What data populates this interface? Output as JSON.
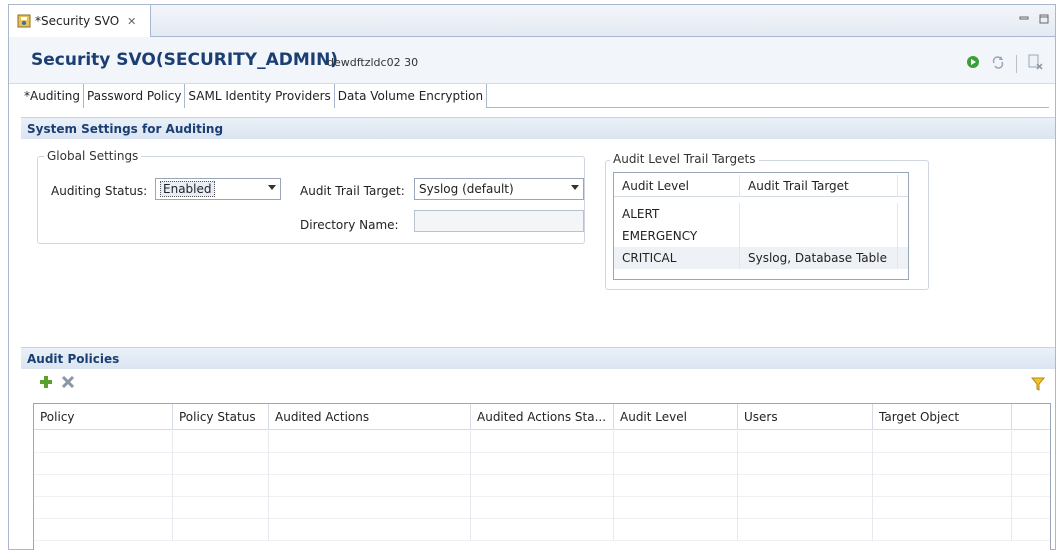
{
  "editor_tab": {
    "title": "*Security SVO",
    "close_glyph": "✕"
  },
  "header": {
    "title": "Security SVO(SECURITY_ADMIN)",
    "subtitle": "dewdftzldc02 30"
  },
  "subtabs": [
    "*Auditing",
    "Password Policy",
    "SAML Identity Providers",
    "Data Volume Encryption"
  ],
  "system_settings": {
    "section_title": "System Settings for Auditing",
    "global_settings_label": "Global Settings",
    "auditing_status_label": "Auditing Status:",
    "auditing_status_value": "Enabled",
    "audit_trail_target_label": "Audit Trail Target:",
    "audit_trail_target_value": "Syslog (default)",
    "directory_name_label": "Directory Name:",
    "directory_name_value": ""
  },
  "audit_level_targets": {
    "group_label": "Audit Level Trail Targets",
    "columns": [
      "Audit Level",
      "Audit Trail Target"
    ],
    "rows": [
      [
        "ALERT",
        ""
      ],
      [
        "EMERGENCY",
        ""
      ],
      [
        "CRITICAL",
        "Syslog, Database Table"
      ]
    ]
  },
  "audit_policies": {
    "section_title": "Audit Policies",
    "columns": [
      "Policy",
      "Policy Status",
      "Audited Actions",
      "Audited Actions Sta...",
      "Audit Level",
      "Users",
      "Target Object"
    ]
  },
  "icons": {
    "tab": "security-editor-icon",
    "run": "activate-icon",
    "refresh": "refresh-icon",
    "close_editor": "close-editor-icon",
    "add": "add-icon",
    "delete": "delete-icon",
    "filter": "filter-icon",
    "minimize": "minimize-icon",
    "maximize": "maximize-icon"
  },
  "colors": {
    "title": "#1b3f73",
    "add": "#5aa02c",
    "run": "#3aa03a",
    "filter": "#f2c230"
  }
}
